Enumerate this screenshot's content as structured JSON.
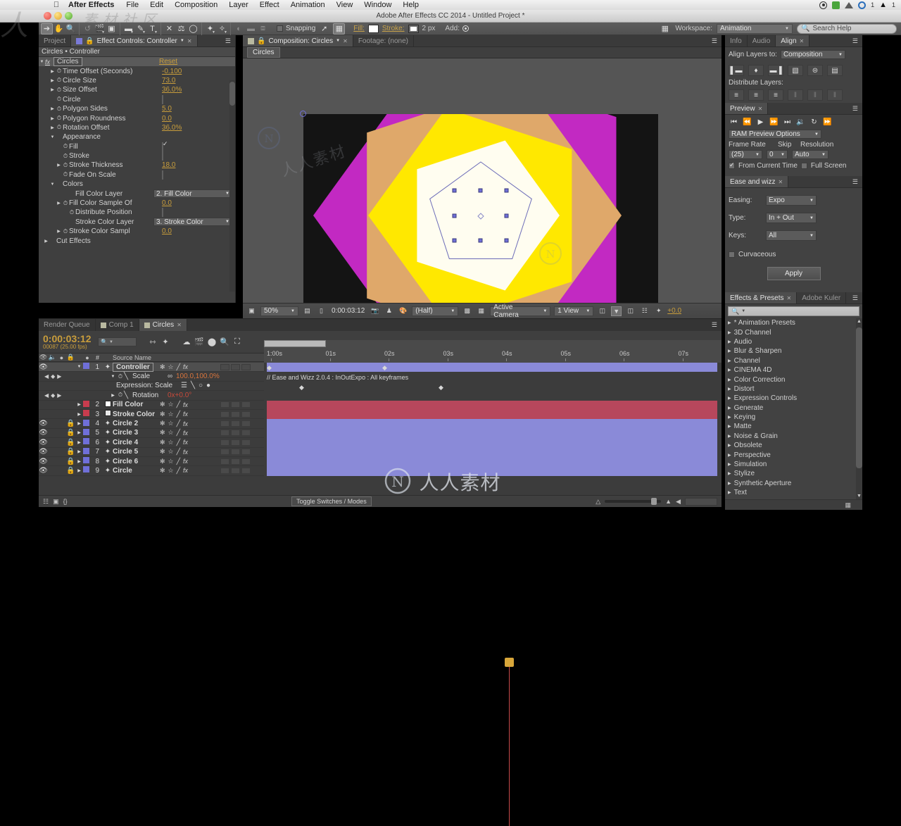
{
  "macbar": {
    "apple": "apple-logo",
    "app_name": "After Effects",
    "menus": [
      "File",
      "Edit",
      "Composition",
      "Layer",
      "Effect",
      "Animation",
      "View",
      "Window",
      "Help"
    ],
    "status_icons": [
      "record-icon",
      "shield-green-icon",
      "drive-icon",
      "creative-cloud-icon",
      "adobe-icon"
    ],
    "cc_count": "1",
    "ai_count": "1"
  },
  "window": {
    "title": "Adobe After Effects CC 2014 - Untitled Project *"
  },
  "toolbar": {
    "tools": [
      "selection-tool",
      "hand-tool",
      "zoom-tool",
      "rotation-tool",
      "camera-tool",
      "pan-behind-tool",
      "shape-tool",
      "pen-tool",
      "text-tool",
      "brush-tool",
      "clone-stamp-tool",
      "eraser-tool",
      "roto-brush-tool",
      "puppet-pin-tool"
    ],
    "snapping_label": "Snapping",
    "snapping_checked": false,
    "fill_label": "Fill:",
    "stroke_label": "Stroke:",
    "stroke_width": "2 px",
    "add_label": "Add:",
    "workspace_label": "Workspace:",
    "workspace_value": "Animation",
    "search_placeholder": "Search Help"
  },
  "effect_controls": {
    "tabs": [
      {
        "label": "Project",
        "active": false
      },
      {
        "label": "Effect Controls: Controller",
        "active": true
      }
    ],
    "header": "Circles • Controller",
    "effect_name": "Circles",
    "reset_label": "Reset",
    "rows": [
      {
        "indent": 1,
        "tri": "right",
        "stopwatch": true,
        "label": "Time Offset (Seconds)",
        "type": "value",
        "value": "-0.100"
      },
      {
        "indent": 1,
        "tri": "right",
        "stopwatch": true,
        "label": "Circle Size",
        "type": "value",
        "value": "73.0"
      },
      {
        "indent": 1,
        "tri": "right",
        "stopwatch": true,
        "label": "Size Offset",
        "type": "value",
        "value": "36.0%"
      },
      {
        "indent": 1,
        "tri": "none",
        "stopwatch": true,
        "label": "Circle",
        "type": "checkbox",
        "checked": false
      },
      {
        "indent": 1,
        "tri": "right",
        "stopwatch": true,
        "label": "Polygon Sides",
        "type": "value",
        "value": "5.0"
      },
      {
        "indent": 1,
        "tri": "right",
        "stopwatch": true,
        "label": "Polygon Roundness",
        "type": "value",
        "value": "0.0"
      },
      {
        "indent": 1,
        "tri": "right",
        "stopwatch": true,
        "label": "Rotation Offset",
        "type": "value",
        "value": "36.0%"
      },
      {
        "indent": 1,
        "tri": "down",
        "stopwatch": false,
        "label": "Appearance",
        "type": "group"
      },
      {
        "indent": 2,
        "tri": "none",
        "stopwatch": true,
        "label": "Fill",
        "type": "checkbox",
        "checked": true
      },
      {
        "indent": 2,
        "tri": "none",
        "stopwatch": true,
        "label": "Stroke",
        "type": "checkbox",
        "checked": false
      },
      {
        "indent": 2,
        "tri": "right",
        "stopwatch": true,
        "label": "Stroke Thickness",
        "type": "value",
        "value": "18.0"
      },
      {
        "indent": 2,
        "tri": "none",
        "stopwatch": true,
        "label": "Fade On Scale",
        "type": "checkbox",
        "checked": false
      },
      {
        "indent": 1,
        "tri": "down",
        "stopwatch": false,
        "label": "Colors",
        "type": "group"
      },
      {
        "indent": 3,
        "tri": "none",
        "stopwatch": false,
        "label": "Fill Color Layer",
        "type": "dropdown",
        "value": "2. Fill Color"
      },
      {
        "indent": 2,
        "tri": "right",
        "stopwatch": true,
        "label": "Fill Color Sample Of",
        "type": "value",
        "value": "0.0"
      },
      {
        "indent": 3,
        "tri": "none",
        "stopwatch": true,
        "label": "Distribute Position",
        "type": "checkbox",
        "checked": false
      },
      {
        "indent": 3,
        "tri": "none",
        "stopwatch": false,
        "label": "Stroke Color Layer",
        "type": "dropdown",
        "value": "3. Stroke Color"
      },
      {
        "indent": 2,
        "tri": "right",
        "stopwatch": true,
        "label": "Stroke Color Sampl",
        "type": "value",
        "value": "0.0"
      },
      {
        "indent": 0,
        "tri": "right",
        "stopwatch": false,
        "label": "Cut Effects",
        "type": "group"
      }
    ]
  },
  "composition": {
    "tabs": [
      {
        "label": "Composition: Circles",
        "active": true
      },
      {
        "label": "Footage: (none)",
        "active": false
      }
    ],
    "breadcrumb": "Circles",
    "zoom": "50%",
    "timecode": "0:00:03:12",
    "resolution": "(Half)",
    "camera": "Active Camera",
    "views": "1 View",
    "exposure": "+0.0",
    "stage_bg": "#141414",
    "shapes": [
      {
        "name": "magenta-pentagon",
        "color": "#c229c2",
        "size": 238,
        "rotation": -18,
        "opacity": 1
      },
      {
        "name": "tan-pentagon",
        "color": "#dfa86a",
        "size": 200,
        "rotation": 18,
        "opacity": 1
      },
      {
        "name": "yellow-pentagon",
        "color": "#ffe800",
        "size": 160,
        "rotation": -18,
        "opacity": 1
      },
      {
        "name": "white-pentagon",
        "color": "#fffdf0",
        "size": 112,
        "rotation": 18,
        "opacity": 1
      },
      {
        "name": "outline-pentagon",
        "color": "#6b6bb8",
        "size": 76,
        "rotation": 0,
        "opacity": 1
      }
    ]
  },
  "align_panel": {
    "tabs": [
      {
        "label": "Info",
        "active": false
      },
      {
        "label": "Audio",
        "active": false
      },
      {
        "label": "Align",
        "active": true
      }
    ],
    "align_to_label": "Align Layers to:",
    "align_to_value": "Composition",
    "distribute_label": "Distribute Layers:",
    "align_buttons": [
      "align-left-icon",
      "align-center-h-icon",
      "align-right-icon",
      "align-top-icon",
      "align-middle-v-icon",
      "align-bottom-icon"
    ],
    "distribute_buttons": [
      "distribute-top-icon",
      "distribute-vcenter-icon",
      "distribute-bottom-icon",
      "distribute-left-icon",
      "distribute-hcenter-icon",
      "distribute-right-icon"
    ]
  },
  "preview_panel": {
    "tab": "Preview",
    "transport": [
      "first-frame-icon",
      "prev-frame-icon",
      "play-icon",
      "next-frame-icon",
      "last-frame-icon",
      "audio-icon",
      "loop-icon",
      "ram-preview-icon"
    ],
    "options_label": "RAM Preview Options",
    "frame_rate_label": "Frame Rate",
    "frame_rate_value": "(25)",
    "skip_label": "Skip",
    "skip_value": "0",
    "resolution_label": "Resolution",
    "resolution_value": "Auto",
    "from_current_time_label": "From Current Time",
    "from_current_time_checked": true,
    "full_screen_label": "Full Screen",
    "full_screen_checked": false
  },
  "ease_panel": {
    "tab": "Ease and wizz",
    "easing_label": "Easing:",
    "easing_value": "Expo",
    "type_label": "Type:",
    "type_value": "In + Out",
    "keys_label": "Keys:",
    "keys_value": "All",
    "curvaceous_label": "Curvaceous",
    "curvaceous_checked": false,
    "apply_label": "Apply"
  },
  "effects_presets": {
    "tabs": [
      {
        "label": "Effects & Presets",
        "active": true
      },
      {
        "label": "Adobe Kuler",
        "active": false
      }
    ],
    "search_placeholder": "",
    "items": [
      "* Animation Presets",
      "3D Channel",
      "Audio",
      "Blur & Sharpen",
      "Channel",
      "CINEMA 4D",
      "Color Correction",
      "Distort",
      "Expression Controls",
      "Generate",
      "Keying",
      "Matte",
      "Noise & Grain",
      "Obsolete",
      "Perspective",
      "Simulation",
      "Stylize",
      "Synthetic Aperture",
      "Text"
    ]
  },
  "timeline": {
    "tabs": [
      {
        "label": "Render Queue",
        "active": false
      },
      {
        "label": "Comp 1",
        "active": false
      },
      {
        "label": "Circles",
        "active": true
      }
    ],
    "timecode": "0:00:03:12",
    "frame_info": "00087 (25.00 fps)",
    "search_placeholder": "",
    "columns": [
      "Source Name"
    ],
    "ruler_ticks": [
      "1:00s",
      "01s",
      "02s",
      "03s",
      "04s",
      "05s",
      "06s",
      "07s"
    ],
    "expression_text": "// Ease and Wizz 2.0.4 : InOutExpo : All keyframes",
    "layers": [
      {
        "num": "1",
        "name": "Controller",
        "color": "#6f6fd8",
        "selected": true,
        "kind": "solid",
        "bar": "#8a8ad8",
        "eye": true,
        "lock": false,
        "boxed": true
      },
      {
        "num": "2",
        "name": "Fill Color",
        "color": "#c83c4e",
        "selected": false,
        "kind": "swatch",
        "swatch": "#ffffff",
        "bar": "#b7475c",
        "eye": false,
        "lock": false
      },
      {
        "num": "3",
        "name": "Stroke Color",
        "color": "#c83c4e",
        "selected": false,
        "kind": "swatch",
        "swatch": "#e8e8e8",
        "bar": "#b7475c",
        "eye": false,
        "lock": false
      },
      {
        "num": "4",
        "name": "Circle 2",
        "color": "#6f6fd8",
        "selected": false,
        "kind": "shape",
        "bar": "#8a8ad8",
        "eye": true,
        "lock": true
      },
      {
        "num": "5",
        "name": "Circle 3",
        "color": "#6f6fd8",
        "selected": false,
        "kind": "shape",
        "bar": "#8a8ad8",
        "eye": true,
        "lock": true
      },
      {
        "num": "6",
        "name": "Circle 4",
        "color": "#6f6fd8",
        "selected": false,
        "kind": "shape",
        "bar": "#8a8ad8",
        "eye": true,
        "lock": true
      },
      {
        "num": "7",
        "name": "Circle 5",
        "color": "#6f6fd8",
        "selected": false,
        "kind": "shape",
        "bar": "#8a8ad8",
        "eye": true,
        "lock": true
      },
      {
        "num": "8",
        "name": "Circle 6",
        "color": "#6f6fd8",
        "selected": false,
        "kind": "shape",
        "bar": "#8a8ad8",
        "eye": true,
        "lock": true
      },
      {
        "num": "9",
        "name": "Circle",
        "color": "#6f6fd8",
        "selected": false,
        "kind": "shape",
        "bar": "#8a8ad8",
        "eye": true,
        "lock": true
      }
    ],
    "properties": [
      {
        "label": "Scale",
        "value": "100.0,100.0%",
        "linked": true,
        "value_color": "#d7743c"
      },
      {
        "label": "Rotation",
        "value": "0x+0.0°",
        "linked": false,
        "value_color": "#c84a3a"
      }
    ],
    "expression_label": "Expression: Scale",
    "toggle_label": "Toggle Switches / Modes"
  },
  "colors": {
    "accent_gold": "#c89d3c",
    "panel_bg": "#3f3f3f",
    "selection": "#4f6fb8"
  }
}
